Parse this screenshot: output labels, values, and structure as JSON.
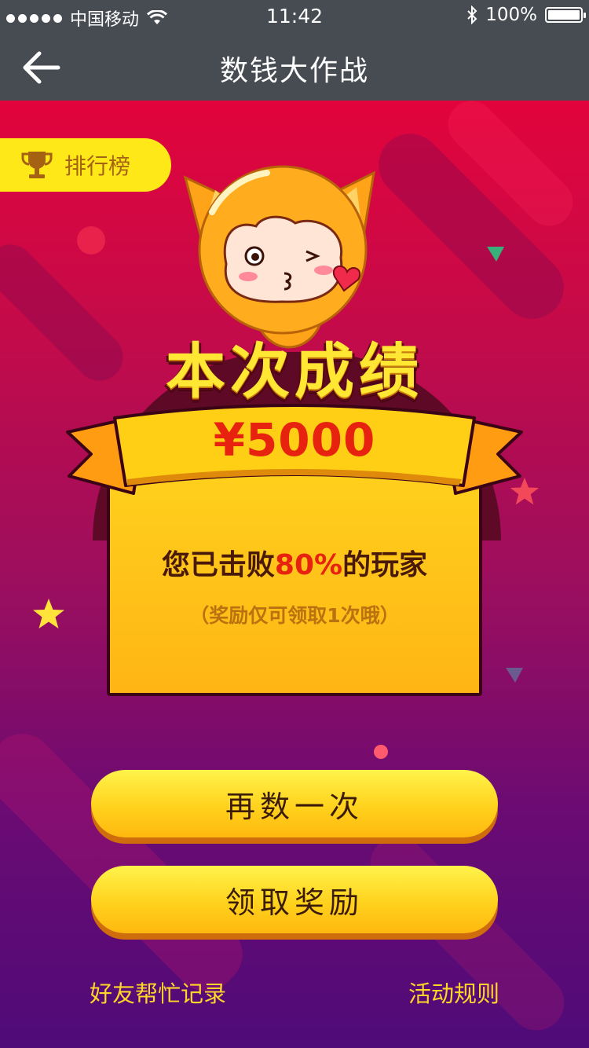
{
  "status_bar": {
    "carrier": "中国移动",
    "time": "11:42",
    "battery": "100%",
    "battery_level": 1.0,
    "icons": [
      "signal-dots-icon",
      "wifi-icon",
      "bluetooth-icon",
      "battery-icon"
    ]
  },
  "nav": {
    "title": "数钱大作战",
    "back_icon": "arrow-left-icon"
  },
  "leaderboard": {
    "label": "排行榜",
    "icon": "trophy-icon"
  },
  "result": {
    "headline": "本次成绩",
    "amount": "¥5000",
    "beat_prefix": "您已击败",
    "beat_percent": "80%",
    "beat_suffix": "的玩家",
    "note": "（奖励仅可领取1次哦）"
  },
  "actions": {
    "retry": "再数一次",
    "claim": "领取奖励"
  },
  "footer": {
    "friends_help": "好友帮忙记录",
    "rules": "活动规则"
  },
  "colors": {
    "bar": "#474b52",
    "accent_yellow": "#ffd21d",
    "accent_red": "#e7230f",
    "bg_top": "#e2043c",
    "bg_bottom": "#4f0b78"
  }
}
